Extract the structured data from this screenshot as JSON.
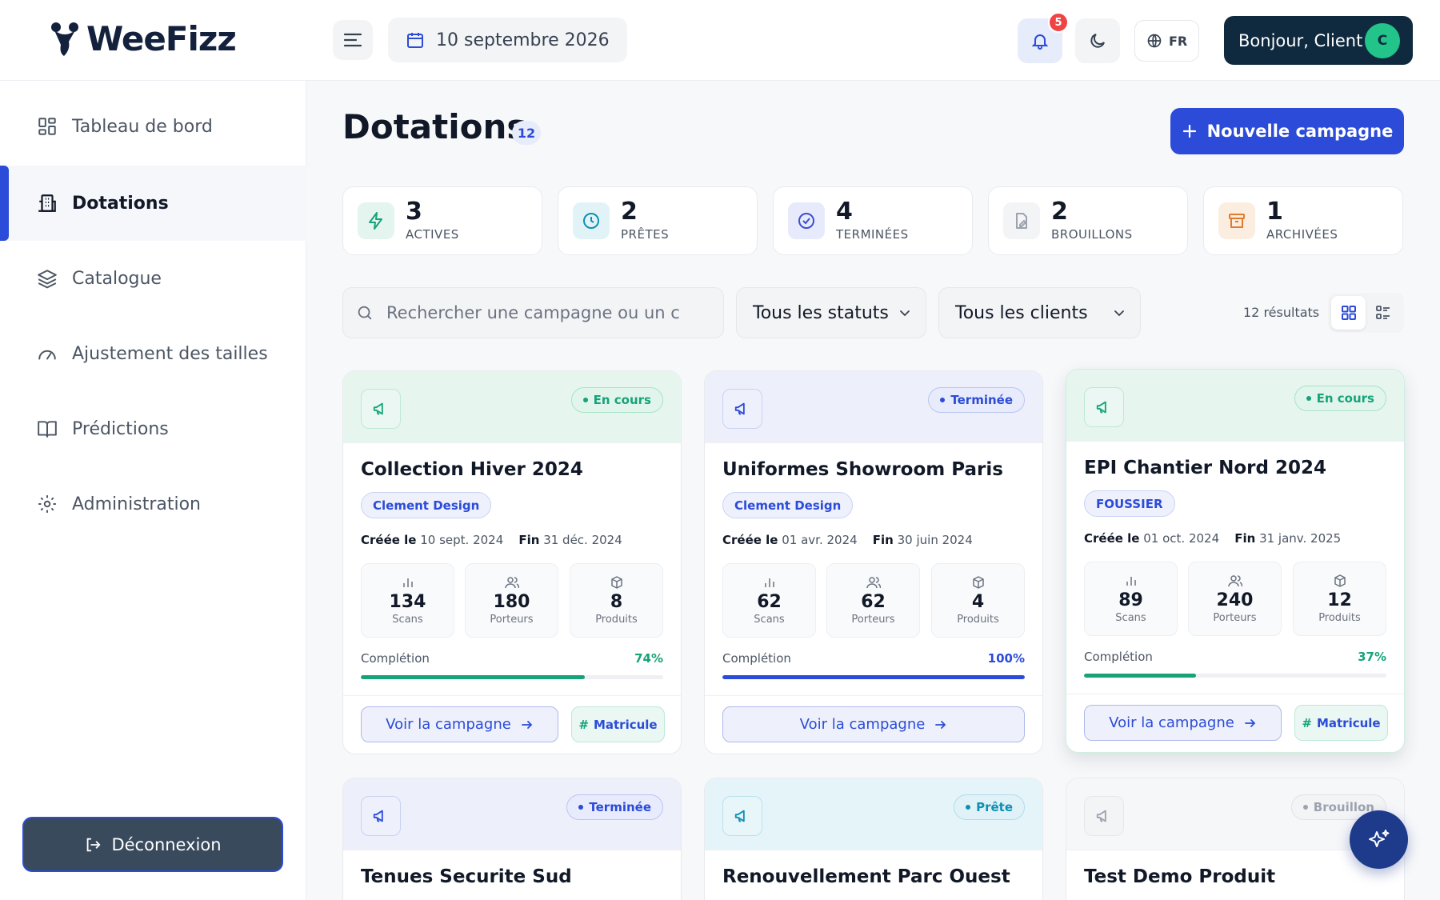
{
  "app": {
    "brand": "WeeFizz",
    "date": "10 septembre 2026",
    "notif_count": "5",
    "lang": "FR",
    "greeting": "Bonjour, Client",
    "avatar_initial": "C"
  },
  "sidebar": {
    "items": [
      {
        "label": "Tableau de bord",
        "icon": "grid-icon",
        "active": false
      },
      {
        "label": "Dotations",
        "icon": "building-icon",
        "active": true
      },
      {
        "label": "Catalogue",
        "icon": "layers-icon",
        "active": false
      },
      {
        "label": "Ajustement des tailles",
        "icon": "gauge-icon",
        "active": false
      },
      {
        "label": "Prédictions",
        "icon": "book-icon",
        "active": false
      },
      {
        "label": "Administration",
        "icon": "gear-icon",
        "active": false
      }
    ],
    "logout": "Déconnexion"
  },
  "page": {
    "title": "Dotations",
    "count": "12",
    "new_button": "Nouvelle campagne"
  },
  "stats": [
    {
      "num": "3",
      "label": "ACTIVES",
      "color": "#16a37a",
      "bg": "#e3f5ee"
    },
    {
      "num": "2",
      "label": "PRÊTES",
      "color": "#0e8fb3",
      "bg": "#e2f3f8"
    },
    {
      "num": "4",
      "label": "TERMINÉES",
      "color": "#3b4fd0",
      "bg": "#e7eafa"
    },
    {
      "num": "2",
      "label": "BROUILLONS",
      "color": "#9ca3af",
      "bg": "#f3f4f6"
    },
    {
      "num": "1",
      "label": "ARCHIVÉES",
      "color": "#e07a2c",
      "bg": "#fcede1"
    }
  ],
  "filters": {
    "search_placeholder": "Rechercher une campagne ou un c",
    "status": "Tous les statuts",
    "client": "Tous les clients",
    "results": "12 résultats"
  },
  "cards": [
    {
      "status": "En cours",
      "title": "Collection Hiver 2024",
      "client": "Clement Design",
      "created_label": "Créée le",
      "created": "10 sept. 2024",
      "end_label": "Fin",
      "end": "31 déc. 2024",
      "scans": "134",
      "scans_lbl": "Scans",
      "porteurs": "180",
      "porteurs_lbl": "Porteurs",
      "produits": "8",
      "produits_lbl": "Produits",
      "comp_lbl": "Complétion",
      "comp": "74%",
      "comp_value": 74,
      "view": "Voir la campagne",
      "matricule": "Matricule"
    },
    {
      "status": "Terminée",
      "title": "Uniformes Showroom Paris",
      "client": "Clement Design",
      "created_label": "Créée le",
      "created": "01 avr. 2024",
      "end_label": "Fin",
      "end": "30 juin 2024",
      "scans": "62",
      "scans_lbl": "Scans",
      "porteurs": "62",
      "porteurs_lbl": "Porteurs",
      "produits": "4",
      "produits_lbl": "Produits",
      "comp_lbl": "Complétion",
      "comp": "100%",
      "comp_value": 100,
      "view": "Voir la campagne"
    },
    {
      "status": "En cours",
      "title": "EPI Chantier Nord 2024",
      "client": "FOUSSIER",
      "created_label": "Créée le",
      "created": "01 oct. 2024",
      "end_label": "Fin",
      "end": "31 janv. 2025",
      "scans": "89",
      "scans_lbl": "Scans",
      "porteurs": "240",
      "porteurs_lbl": "Porteurs",
      "produits": "12",
      "produits_lbl": "Produits",
      "comp_lbl": "Complétion",
      "comp": "37%",
      "comp_value": 37,
      "view": "Voir la campagne",
      "matricule": "Matricule"
    },
    {
      "status": "Terminée",
      "title": "Tenues Securite Sud"
    },
    {
      "status": "Prête",
      "title": "Renouvellement Parc Ouest"
    },
    {
      "status": "Brouillon",
      "title": "Test Demo Produit"
    }
  ],
  "colors": {
    "accent": "#2b4bd8",
    "green": "#16a37a",
    "navy": "#0f2a3f"
  }
}
